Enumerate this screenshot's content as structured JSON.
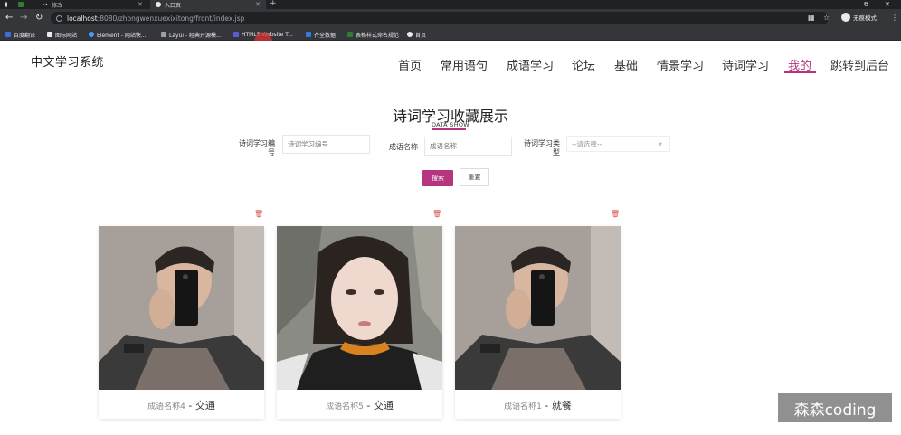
{
  "browser": {
    "tabs": [
      {
        "label": "",
        "active": false
      },
      {
        "label": "",
        "active": false
      },
      {
        "label": "修改",
        "active": false
      },
      {
        "label": "入口页",
        "active": true
      }
    ],
    "url_host": "localhost",
    "url_path": ":8080/zhongwenxuexixitong/front/index.jsp",
    "incognito_label": "无痕模式",
    "bookmarks": [
      {
        "label": "百度翻译",
        "color": "#3b6fd9"
      },
      {
        "label": "图标网站",
        "color": "#e8eaed"
      },
      {
        "label": "Element - 网站快...",
        "color": "#409eff"
      },
      {
        "label": "Layui - 经典开源模...",
        "color": "#9aa0a6"
      },
      {
        "label": "HTML5 Website T...",
        "color": "#5b5bd6"
      },
      {
        "label": "齐全数据",
        "color": "#2f7ae5"
      },
      {
        "label": "表格样式命名规范",
        "color": "#2e7d32"
      },
      {
        "label": "首页",
        "color": "#e8eaed"
      }
    ]
  },
  "site": {
    "logo": "中文学习系统",
    "nav": [
      {
        "label": "首页",
        "active": false
      },
      {
        "label": "常用语句",
        "active": false
      },
      {
        "label": "成语学习",
        "active": false
      },
      {
        "label": "论坛",
        "active": false
      },
      {
        "label": "基础",
        "active": false
      },
      {
        "label": "情景学习",
        "active": false
      },
      {
        "label": "诗词学习",
        "active": false
      },
      {
        "label": "我的",
        "active": true
      },
      {
        "label": "跳转到后台",
        "active": false
      }
    ],
    "accent_color": "#b5357f"
  },
  "content": {
    "title": "诗词学习收藏展示",
    "subtitle": "DATA SHOW",
    "filters": {
      "number_label_1": "诗词学习编",
      "number_label_2": "号",
      "number_placeholder": "诗词学习编号",
      "name_label": "成语名称",
      "name_placeholder": "成语名称",
      "type_label_1": "诗词学习类",
      "type_label_2": "型",
      "type_selected": "--请选择--",
      "search_button": "搜索",
      "reset_button": "重置"
    },
    "cards": [
      {
        "name": "成语名称4",
        "separator": " - ",
        "type": "交通",
        "icon": "male-selfie-photo"
      },
      {
        "name": "成语名称5",
        "separator": " - ",
        "type": "交通",
        "icon": "female-portrait-photo"
      },
      {
        "name": "成语名称1",
        "separator": " - ",
        "type": "就餐",
        "icon": "male-selfie-photo"
      }
    ],
    "delete_icon": "trash-icon"
  },
  "watermark": "森森coding"
}
